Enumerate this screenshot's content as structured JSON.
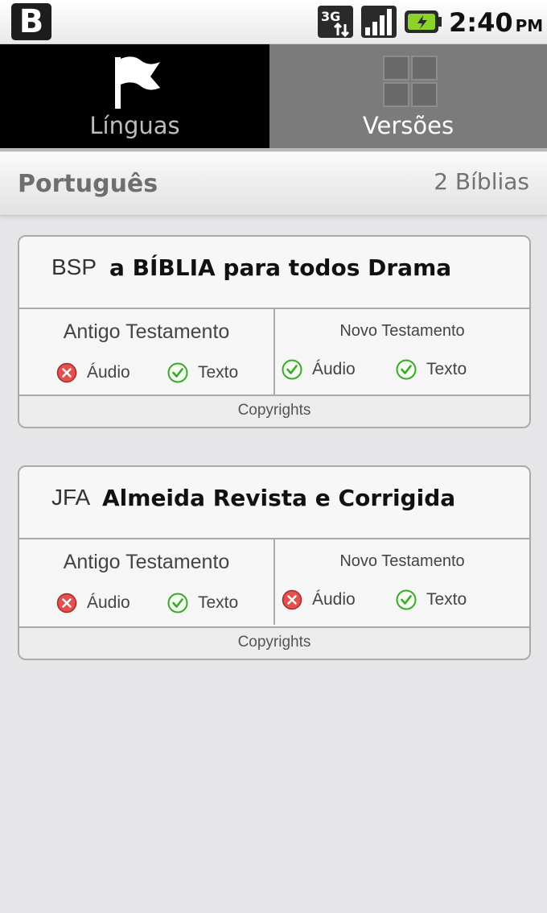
{
  "status_bar": {
    "app_letter": "B",
    "network": "3G",
    "time": "2:40",
    "ampm": "PM"
  },
  "tabs": [
    {
      "label": "Línguas",
      "icon": "flag-icon",
      "active": true
    },
    {
      "label": "Versões",
      "icon": "grid-icon",
      "active": false
    }
  ],
  "section": {
    "title": "Português",
    "count": "2 Bíblias"
  },
  "bibles": [
    {
      "abbr": "BSP",
      "name": "a BÍBLIA para todos Drama",
      "old_testament": {
        "title": "Antigo Testamento",
        "audio_label": "Áudio",
        "audio_available": false,
        "text_label": "Texto",
        "text_available": true
      },
      "new_testament": {
        "title": "Novo Testamento",
        "audio_label": "Áudio",
        "audio_available": true,
        "text_label": "Texto",
        "text_available": true
      },
      "copyrights": "Copyrights"
    },
    {
      "abbr": "JFA",
      "name": "Almeida Revista e Corrigida",
      "old_testament": {
        "title": "Antigo Testamento",
        "audio_label": "Áudio",
        "audio_available": false,
        "text_label": "Texto",
        "text_available": true
      },
      "new_testament": {
        "title": "Novo Testamento",
        "audio_label": "Áudio",
        "audio_available": false,
        "text_label": "Texto",
        "text_available": true
      },
      "copyrights": "Copyrights"
    }
  ],
  "colors": {
    "available": "#3aa82b",
    "unavailable": "#d23a3a",
    "active_tab": "#000000",
    "inactive_tab": "#7b7b7b"
  }
}
